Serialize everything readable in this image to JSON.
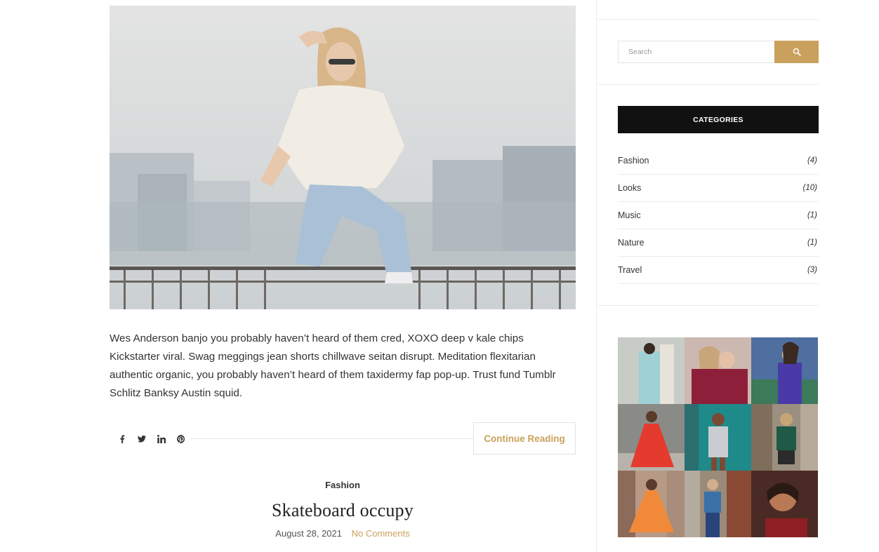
{
  "post": {
    "excerpt": "Wes Anderson banjo you probably haven’t heard of them cred, XOXO deep v kale chips Kickstarter viral. Swag meggings jean shorts chillwave seitan disrupt. Meditation flexitarian authentic organic, you probably haven’t heard of them taxidermy fap pop-up. Trust fund Tumblr Schlitz Banksy Austin squid.",
    "continue_label": "Continue Reading",
    "share_icons": [
      "facebook-icon",
      "twitter-icon",
      "linkedin-icon",
      "pinterest-icon"
    ]
  },
  "next_post": {
    "category": "Fashion",
    "title": "Skateboard occupy",
    "date": "August 28, 2021",
    "comments": "No Comments"
  },
  "sidebar": {
    "search": {
      "placeholder": "Search"
    },
    "categories_title": "CATEGORIES",
    "categories": [
      {
        "name": "Fashion",
        "count": "(4)"
      },
      {
        "name": "Looks",
        "count": "(10)"
      },
      {
        "name": "Music",
        "count": "(1)"
      },
      {
        "name": "Nature",
        "count": "(1)"
      },
      {
        "name": "Travel",
        "count": "(3)"
      }
    ]
  },
  "colors": {
    "accent": "#c9a15c",
    "header_bg": "#111111",
    "border": "#ececec"
  }
}
